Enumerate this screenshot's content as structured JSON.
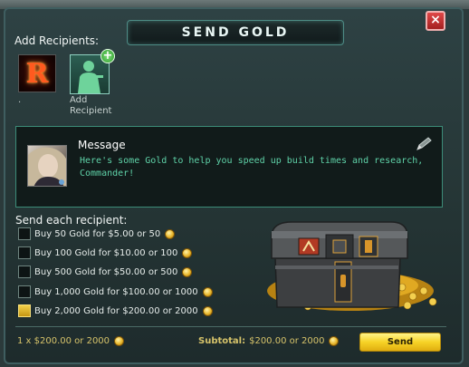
{
  "dialog": {
    "title": "SEND GOLD",
    "close_label": "×"
  },
  "recipients": {
    "heading": "Add Recipients:",
    "existing": [
      {
        "initial": "R",
        "name": "."
      }
    ],
    "add_label": "Add\nRecipient"
  },
  "message": {
    "title": "Message",
    "text": "Here's some Gold to help you speed up build times and research, Commander!"
  },
  "send_each": {
    "heading": "Send each recipient:",
    "options": [
      {
        "label": "Buy 50 Gold for $5.00 or 50",
        "checked": false
      },
      {
        "label": "Buy 100 Gold for $10.00 or 100",
        "checked": false
      },
      {
        "label": "Buy 500 Gold for $50.00 or 500",
        "checked": false
      },
      {
        "label": "Buy 1,000 Gold for $100.00 or 1000",
        "checked": false
      },
      {
        "label": "Buy 2,000 Gold for $200.00 or 2000",
        "checked": true
      }
    ]
  },
  "footer": {
    "quantity_text": "1 x $200.00 or 2000",
    "subtotal_label": "Subtotal:",
    "subtotal_value": "$200.00 or 2000",
    "send_label": "Send"
  },
  "colors": {
    "accent_gold": "#f6d326",
    "message_text": "#5fd2a8",
    "close_red": "#c93030"
  },
  "icons": [
    "close-icon",
    "plus-icon",
    "pencil-icon",
    "gold-coin-icon",
    "treasure-chest-icon"
  ]
}
